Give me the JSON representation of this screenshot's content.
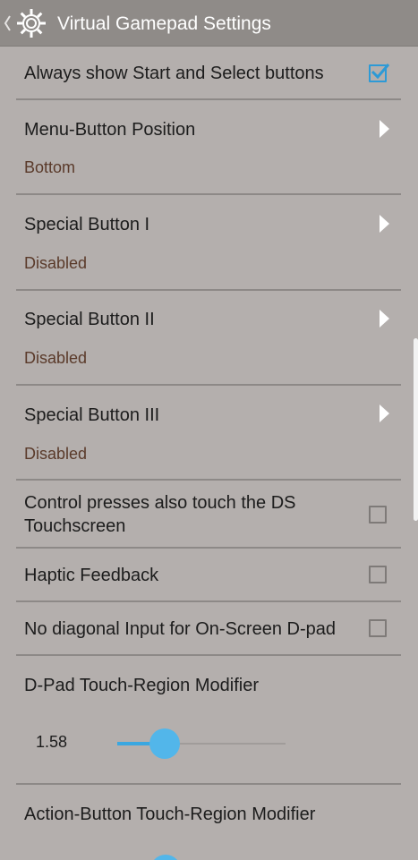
{
  "action_bar": {
    "title": "Virtual Gamepad Settings",
    "back_icon": "chevron-left-icon",
    "app_icon": "gear-icon"
  },
  "settings": {
    "always_show_start_select": {
      "title": "Always show Start and Select buttons",
      "checked": true
    },
    "menu_button_position": {
      "title": "Menu-Button Position",
      "summary": "Bottom"
    },
    "special_button_1": {
      "title": "Special Button I",
      "summary": "Disabled"
    },
    "special_button_2": {
      "title": "Special Button II",
      "summary": "Disabled"
    },
    "special_button_3": {
      "title": "Special Button III",
      "summary": "Disabled"
    },
    "control_presses_touch": {
      "title_line1": "Control presses also touch the DS",
      "title_line2": "Touchscreen",
      "checked": false
    },
    "haptic_feedback": {
      "title": "Haptic Feedback",
      "checked": false
    },
    "no_diagonal_input": {
      "title": "No diagonal Input for On-Screen D-pad",
      "checked": false
    },
    "dpad_touch_region": {
      "title": "D-Pad Touch-Region Modifier",
      "value": "1.58",
      "fraction": 0.28
    },
    "action_button_touch_region": {
      "title": "Action-Button Touch-Region Modifier"
    }
  },
  "colors": {
    "background": "#b4afad",
    "action_bar": "#8f8b88",
    "accent": "#3aa7e0",
    "summary_text": "#5a3a2a"
  }
}
